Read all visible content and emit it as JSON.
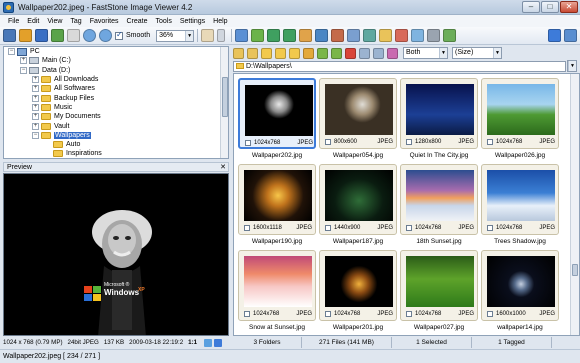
{
  "window": {
    "title": "Wallpaper202.jpeg  -  FastStone Image Viewer 4.2",
    "min_label": "–",
    "max_label": "□",
    "close_label": "✕"
  },
  "menu": {
    "items": [
      "File",
      "Edit",
      "View",
      "Tag",
      "Favorites",
      "Create",
      "Tools",
      "Settings",
      "Help"
    ]
  },
  "toolbar": {
    "smooth_label": "Smooth",
    "smooth_checked": true,
    "zoom_value": "36%",
    "filter_value": "Both",
    "sort_value": "(Size)"
  },
  "tree": {
    "items": [
      {
        "label": "PC",
        "indent": 0,
        "icon": "pc-icon",
        "expander": "−"
      },
      {
        "label": "Main (C:)",
        "indent": 1,
        "icon": "drive-icon",
        "expander": "+"
      },
      {
        "label": "Data (D:)",
        "indent": 1,
        "icon": "drive-icon",
        "expander": "−"
      },
      {
        "label": "All Downloads",
        "indent": 2,
        "icon": "folder-icon",
        "expander": "+"
      },
      {
        "label": "All Softwares",
        "indent": 2,
        "icon": "folder-icon",
        "expander": "+"
      },
      {
        "label": "Backup Files",
        "indent": 2,
        "icon": "folder-icon",
        "expander": "+"
      },
      {
        "label": "Music",
        "indent": 2,
        "icon": "folder-icon",
        "expander": "+"
      },
      {
        "label": "My Documents",
        "indent": 2,
        "icon": "folder-icon",
        "expander": "+"
      },
      {
        "label": "Vault",
        "indent": 2,
        "icon": "folder-icon",
        "expander": "+"
      },
      {
        "label": "Wallpapers",
        "indent": 2,
        "icon": "folder-icon",
        "expander": "−",
        "selected": true
      },
      {
        "label": "Auto",
        "indent": 3,
        "icon": "folder-icon",
        "expander": ""
      },
      {
        "label": "Inspirations",
        "indent": 3,
        "icon": "folder-icon",
        "expander": ""
      }
    ]
  },
  "preview": {
    "title": "Preview",
    "close_label": "✕",
    "logo_top": "Microsoft ®",
    "logo_main": "Windows",
    "logo_sup": "XP",
    "status": {
      "dimensions": "1024 x 768 (0.79 MP)",
      "color": "24bit JPEG",
      "size": "137 KB",
      "date": "2009-03-18 22:19:2",
      "ratio": "1:1"
    }
  },
  "path": {
    "value": "D:\\Wallpapers\\"
  },
  "thumbnails": [
    {
      "name": "Wallpaper202.jpg",
      "dims": "1024x768",
      "format": "JPEG",
      "selected": true,
      "art": "art-einstein"
    },
    {
      "name": "Wallpaper054.jpg",
      "dims": "800x600",
      "format": "JPEG",
      "selected": false,
      "art": "art-einstein2"
    },
    {
      "name": "Quiet In The City.jpg",
      "dims": "1280x800",
      "format": "JPEG",
      "selected": false,
      "art": "art-quiet"
    },
    {
      "name": "Wallpaper026.jpg",
      "dims": "1024x768",
      "format": "JPEG",
      "selected": false,
      "art": "art-wp26"
    },
    {
      "name": "Wallpaper190.jpg",
      "dims": "1600x1118",
      "format": "JPEG",
      "selected": false,
      "art": "art-wp190"
    },
    {
      "name": "Wallpaper187.jpg",
      "dims": "1440x900",
      "format": "JPEG",
      "selected": false,
      "art": "art-wp187"
    },
    {
      "name": "18th Sunset.jpg",
      "dims": "1024x768",
      "format": "JPEG",
      "selected": false,
      "art": "art-sunset18"
    },
    {
      "name": "Trees Shadow.jpg",
      "dims": "1024x768",
      "format": "JPEG",
      "selected": false,
      "art": "art-trees"
    },
    {
      "name": "Snow at Sunset.jpg",
      "dims": "1024x768",
      "format": "JPEG",
      "selected": false,
      "art": "art-snow"
    },
    {
      "name": "Wallpaper201.jpg",
      "dims": "1024x768",
      "format": "JPEG",
      "selected": false,
      "art": "art-wp201"
    },
    {
      "name": "Wallpaper027.jpg",
      "dims": "1024x768",
      "format": "JPEG",
      "selected": false,
      "art": "art-wp27"
    },
    {
      "name": "wallpaper14.jpg",
      "dims": "1600x1000",
      "format": "JPEG",
      "selected": false,
      "art": "art-wp14"
    }
  ],
  "status": {
    "folders": "3 Folders",
    "files": "271 Files (141 MB)",
    "selected": "1 Selected",
    "tagged": "1 Tagged"
  },
  "bottom": {
    "text": "Wallpaper202.jpeg [ 234 / 271 ]"
  },
  "colors": {
    "selection": "#3169c6",
    "thumb_selected_border": "#3d7bd9",
    "panel_bg": "#dfe6ef"
  }
}
